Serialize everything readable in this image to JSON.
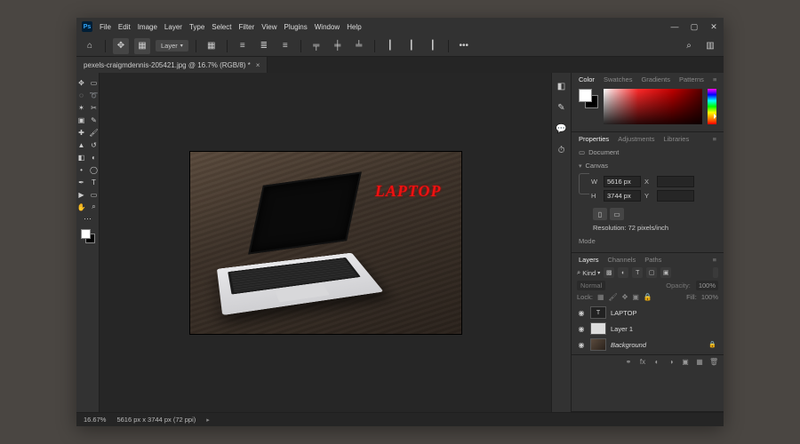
{
  "menubar": {
    "app_icon": "Ps",
    "items": [
      "File",
      "Edit",
      "Image",
      "Layer",
      "Type",
      "Select",
      "Filter",
      "View",
      "Plugins",
      "Window",
      "Help"
    ]
  },
  "window_controls": {
    "minimize": "—",
    "maximize": "▢",
    "close": "✕"
  },
  "optbar": {
    "layer_label": "Layer",
    "more": "•••"
  },
  "doc_tab": {
    "title": "pexels-craigmdennis-205421.jpg @ 16.7% (RGB/8) *",
    "close": "×"
  },
  "dock": {
    "icons": [
      "◧",
      "✎",
      "💬",
      "⏱"
    ]
  },
  "canvas": {
    "overlay_text": "LAPTOP"
  },
  "panels": {
    "color": {
      "tabs": [
        "Color",
        "Swatches",
        "Gradients",
        "Patterns"
      ],
      "active": 0
    },
    "properties": {
      "tabs": [
        "Properties",
        "Adjustments",
        "Libraries"
      ],
      "active": 0,
      "doc_label": "Document",
      "section": "Canvas",
      "w_label": "W",
      "w_value": "5616 px",
      "x_label": "X",
      "x_value": "",
      "h_label": "H",
      "h_value": "3744 px",
      "y_label": "Y",
      "y_value": "",
      "resolution": "Resolution: 72 pixels/inch",
      "mode": "Mode"
    },
    "layers": {
      "tabs": [
        "Layers",
        "Channels",
        "Paths"
      ],
      "active": 0,
      "kind": "Kind",
      "blend": "Normal",
      "opacity_label": "Opacity:",
      "opacity_value": "100%",
      "lock_label": "Lock:",
      "fill_label": "Fill:",
      "fill_value": "100%",
      "items": [
        {
          "type": "T",
          "name": "LAPTOP"
        },
        {
          "type": "img",
          "name": "Layer 1"
        },
        {
          "type": "bg",
          "name": "Background"
        }
      ]
    }
  },
  "statusbar": {
    "zoom": "16.67%",
    "info": "5616 px x 3744 px (72 ppi)"
  }
}
